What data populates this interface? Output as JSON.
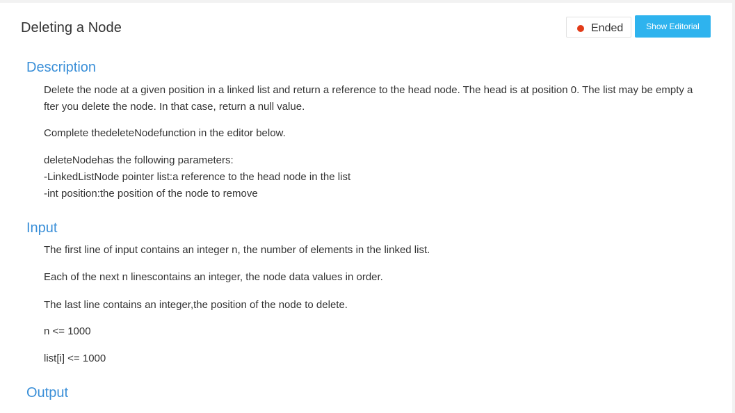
{
  "header": {
    "title": "Deleting a Node",
    "status": {
      "label": "Ended",
      "color": "#e23a17"
    },
    "editorial_button": "Show Editorial"
  },
  "description": {
    "heading": "Description",
    "intro": "Delete the node at a given position in a linked list and return a reference to the head node. The head is at position 0. The list may be empty after you delete the node. In that case, return a null value.",
    "complete": "Complete thedeleteNodefunction in the editor below.",
    "params_title": "deleteNodehas the following parameters:",
    "param1": "-LinkedListNode pointer list:a reference to the head node in the list",
    "param2": "-int position:the position of the node to remove"
  },
  "input": {
    "heading": "Input",
    "line1": "The first line of input contains an integer n, the number of elements in the linked list.",
    "line2": "Each of the next n linescontains an integer, the node data values in order.",
    "line3": "The last line contains an integer,the position of the node to delete.",
    "constraint1": "n <= 1000",
    "constraint2": "list[i] <= 1000"
  },
  "output": {
    "heading": "Output"
  }
}
